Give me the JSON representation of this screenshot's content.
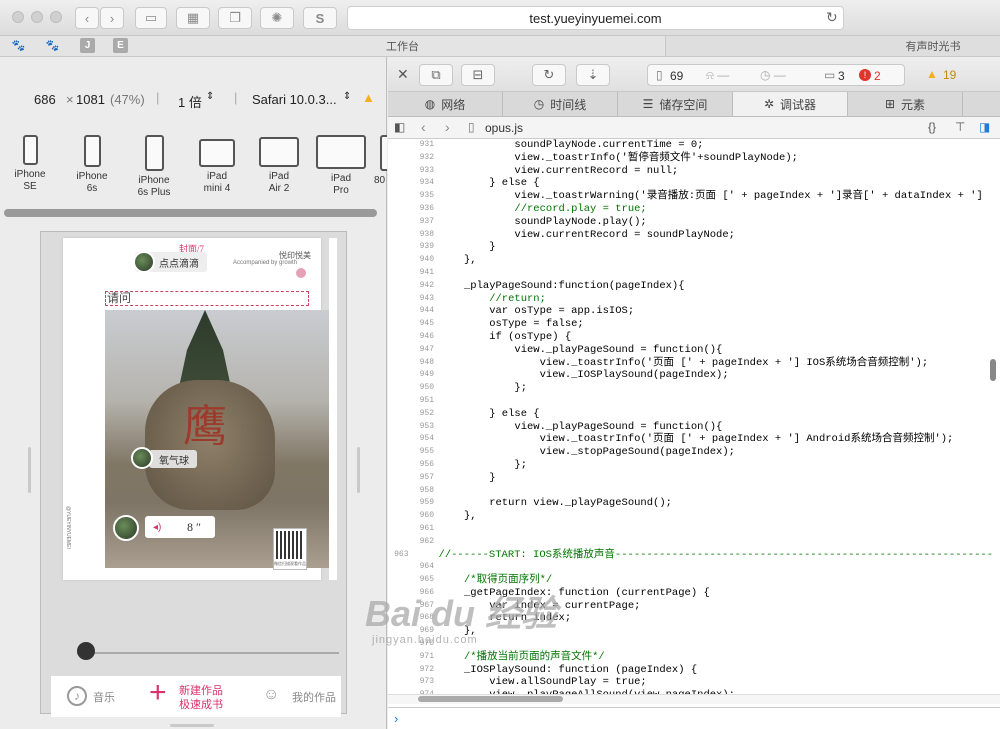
{
  "browser": {
    "url": "test.yueyinyuemei.com",
    "toolbar_icon_text": "S",
    "tabs": [
      {
        "label": "工作台"
      },
      {
        "label": "有声时光书"
      }
    ],
    "favorites": [
      {
        "icon": "paw-icon"
      },
      {
        "icon": "paw-icon"
      },
      {
        "label": "J"
      },
      {
        "label": "E"
      }
    ]
  },
  "responsive": {
    "width": "686",
    "times": "×",
    "height": "1081",
    "percent": "(47%)",
    "scale": "1 倍",
    "ua": "Safari 10.0.3...",
    "devices": [
      {
        "line1": "iPhone",
        "line2": "SE"
      },
      {
        "line1": "iPhone",
        "line2": "6s"
      },
      {
        "line1": "iPhone",
        "line2": "6s Plus"
      },
      {
        "line1": "iPad",
        "line2": "mini 4"
      },
      {
        "line1": "iPad",
        "line2": "Air 2"
      },
      {
        "line1": "iPad",
        "line2": "Pro"
      },
      {
        "line1": "80",
        "line2": ""
      }
    ]
  },
  "preview": {
    "page_label": "封面/7",
    "author_name": "点点滴滴",
    "brand": "悦印悦美",
    "brand_sub": "Accompanied by growth",
    "title_placeholder": "请问",
    "balloon": "氧气球",
    "duration": "8 ″",
    "vertical_text": "@YUEYINYUEMEI",
    "qr_caption": "微信扫描观看作品",
    "nav_music": "音乐",
    "nav_new1": "新建作品",
    "nav_new2": "极速成书",
    "nav_mine": "我的作品"
  },
  "inspector": {
    "status": {
      "resources": "69",
      "logs": "3",
      "errors": "2",
      "warnings": "19"
    },
    "tabs": [
      {
        "label": "网络",
        "icon": "network-icon"
      },
      {
        "label": "时间线",
        "icon": "clock-icon"
      },
      {
        "label": "储存空间",
        "icon": "database-icon"
      },
      {
        "label": "调试器",
        "icon": "bug-icon"
      },
      {
        "label": "元素",
        "icon": "elements-icon"
      }
    ],
    "file": "opus.js",
    "code": [
      {
        "n": "931",
        "t": "        soundPlayNode.currentTime = 0;"
      },
      {
        "n": "932",
        "t": "        view._toastrInfo('暂停音频文件'+soundPlayNode);"
      },
      {
        "n": "933",
        "t": "        view.currentRecord = null;"
      },
      {
        "n": "934",
        "t": "    } else {"
      },
      {
        "n": "935",
        "t": "        view._toastrWarning('录音播放:页面 [' + pageIndex + ']录音[' + dataIndex + ']"
      },
      {
        "n": "936",
        "t": "        //record.play = true;"
      },
      {
        "n": "937",
        "t": "        soundPlayNode.play();"
      },
      {
        "n": "938",
        "t": "        view.currentRecord = soundPlayNode;"
      },
      {
        "n": "939",
        "t": "    }"
      },
      {
        "n": "940",
        "t": "},"
      },
      {
        "n": "941",
        "t": ""
      },
      {
        "n": "942",
        "t": "_playPageSound:function(pageIndex){"
      },
      {
        "n": "943",
        "t": "    //return;"
      },
      {
        "n": "944",
        "t": "    var osType = app.isIOS;"
      },
      {
        "n": "945",
        "t": "    osType = false;"
      },
      {
        "n": "946",
        "t": "    if (osType) {"
      },
      {
        "n": "947",
        "t": "        view._playPageSound = function(){"
      },
      {
        "n": "948",
        "t": "            view._toastrInfo('页面 [' + pageIndex + '] IOS系统场合音频控制');"
      },
      {
        "n": "949",
        "t": "            view._IOSPlaySound(pageIndex);"
      },
      {
        "n": "950",
        "t": "        };"
      },
      {
        "n": "951",
        "t": ""
      },
      {
        "n": "952",
        "t": "    } else {"
      },
      {
        "n": "953",
        "t": "        view._playPageSound = function(){"
      },
      {
        "n": "954",
        "t": "            view._toastrInfo('页面 [' + pageIndex + '] Android系统场合音频控制');"
      },
      {
        "n": "955",
        "t": "            view._stopPageSound(pageIndex);"
      },
      {
        "n": "956",
        "t": "        };"
      },
      {
        "n": "957",
        "t": "    }"
      },
      {
        "n": "958",
        "t": ""
      },
      {
        "n": "959",
        "t": "    return view._playPageSound();"
      },
      {
        "n": "960",
        "t": "},"
      },
      {
        "n": "961",
        "t": ""
      },
      {
        "n": "962",
        "t": ""
      },
      {
        "n": "963",
        "t": "//------START: IOS系统播放声音------------------------------------------------------------"
      },
      {
        "n": "964",
        "t": ""
      },
      {
        "n": "965",
        "t": "/*取得页面序列*/"
      },
      {
        "n": "966",
        "t": "_getPageIndex: function (currentPage) {"
      },
      {
        "n": "967",
        "t": "    var index = currentPage;"
      },
      {
        "n": "968",
        "t": "    return index;"
      },
      {
        "n": "969",
        "t": "},"
      },
      {
        "n": "970",
        "t": ""
      },
      {
        "n": "971",
        "t": "/*播放当前页面的声音文件*/"
      },
      {
        "n": "972",
        "t": "_IOSPlaySound: function (pageIndex) {"
      },
      {
        "n": "973",
        "t": "    view.allSoundPlay = true;"
      },
      {
        "n": "974",
        "t": "    view._playPageAllSound(view.pageIndex);"
      }
    ]
  },
  "watermark": {
    "main": "Bai du 经验",
    "sub": "jingyan.baidu.com"
  },
  "colors": {
    "keyword": "#a90d91",
    "string": "#c41a16",
    "comment": "#007400",
    "accent": "#d8336a",
    "warning": "#f2b01e",
    "error": "#e0352b"
  }
}
